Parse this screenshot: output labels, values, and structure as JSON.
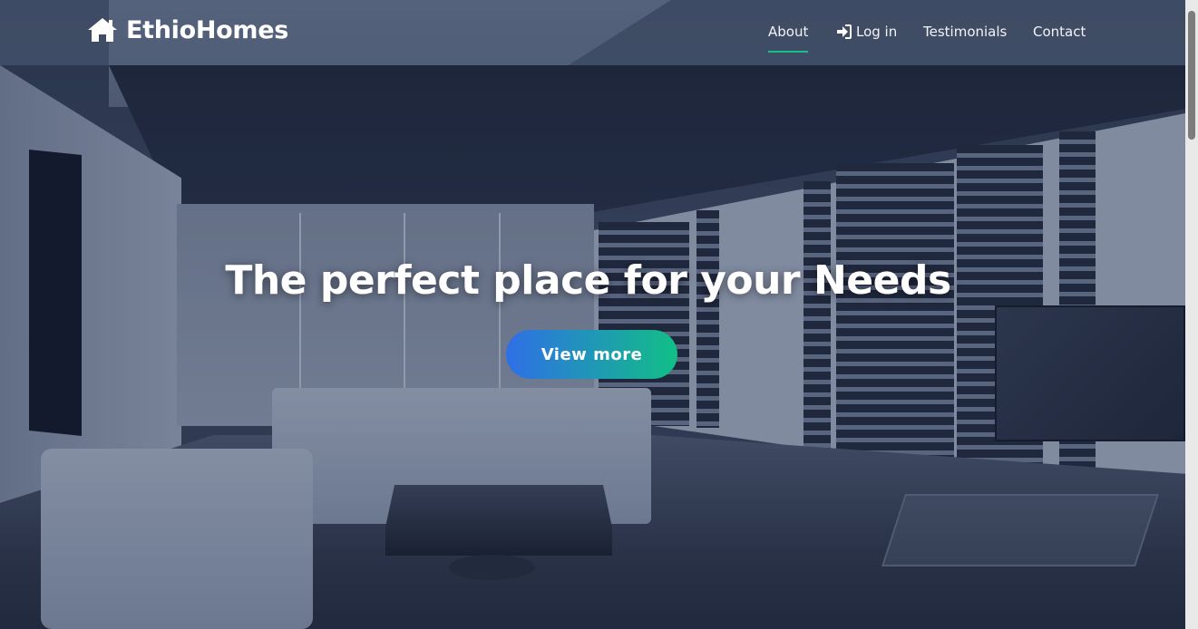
{
  "brand": {
    "name": "EthioHomes",
    "icon": "home-icon"
  },
  "nav": {
    "items": [
      {
        "label": "About",
        "active": true
      },
      {
        "label": "Log in",
        "icon": "sign-in-icon"
      },
      {
        "label": "Testimonials"
      },
      {
        "label": "Contact"
      }
    ]
  },
  "hero": {
    "headline": "The perfect place for your Needs",
    "cta_label": "View more"
  },
  "colors": {
    "accent_green": "#16c08a",
    "button_gradient_start": "#2f6fe6",
    "button_gradient_end": "#11bf86",
    "text": "#ffffff"
  }
}
